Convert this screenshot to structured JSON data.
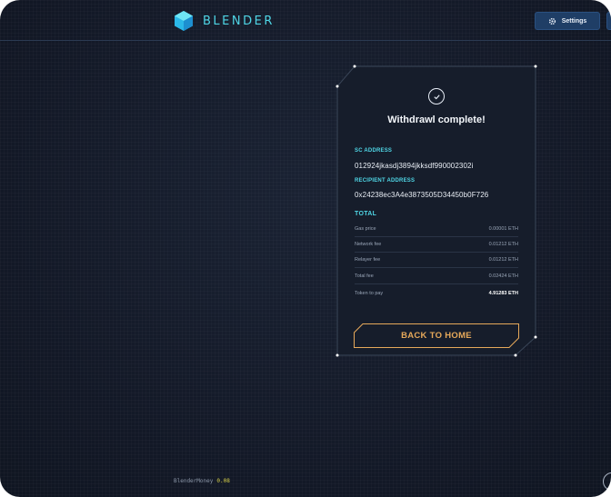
{
  "app": {
    "name": "BLENDER"
  },
  "header": {
    "settings_label": "Settings"
  },
  "card": {
    "title": "Withdrawl complete!",
    "sc_address_label": "SC ADDRESS",
    "sc_address": "012924jkasdj3894jkksdf990002302i",
    "recipient_label": "RECIPIENT ADDRESS",
    "recipient_address": "0x24238ec3A4e3873505D34450b0F726",
    "total_label": "TOTAL",
    "fees": [
      {
        "label": "Gas price",
        "value": "0.00001 ETH"
      },
      {
        "label": "Network fee",
        "value": "0.01212 ETH"
      },
      {
        "label": "Relayer fee",
        "value": "0.01212 ETH"
      },
      {
        "label": "Total fee",
        "value": "0.02424 ETH"
      },
      {
        "label": "Token to pay",
        "value": "4.91283 ETH"
      }
    ],
    "back_label": "BACK TO HOME"
  },
  "footer": {
    "app_label": "BlenderMoney",
    "version": "0.08"
  },
  "colors": {
    "accent": "#4fd6e6",
    "button_border": "#e6a95a",
    "background": "#131a27"
  }
}
